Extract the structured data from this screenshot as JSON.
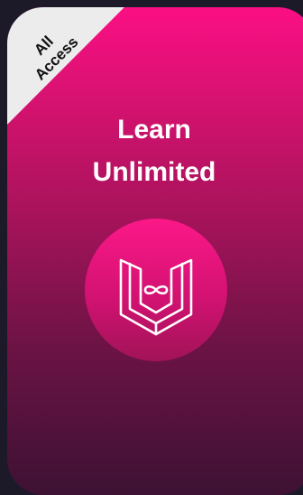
{
  "ribbon": {
    "label": "All\nAccess"
  },
  "hero": {
    "title_line1": "Learn",
    "title_line2": "Unlimited"
  },
  "logo": {
    "icon": "infinity-book-icon"
  },
  "colors": {
    "gradient_top": "#fb0f84",
    "gradient_bottom": "#3d1233",
    "background": "#1c1929",
    "ribbon": "#ececec"
  }
}
